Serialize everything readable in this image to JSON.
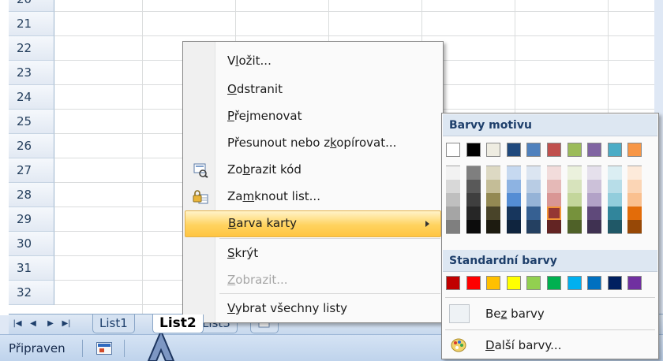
{
  "sheet": {
    "rows": [
      "20",
      "21",
      "22",
      "23",
      "24",
      "25",
      "26",
      "27",
      "28",
      "29",
      "30",
      "31",
      "32"
    ]
  },
  "tabs": {
    "items": [
      {
        "label": "List1",
        "active": false
      },
      {
        "label": "List2",
        "active": true
      },
      {
        "label": "List3",
        "active": false
      }
    ]
  },
  "status": {
    "text": "Připraven"
  },
  "context_menu": {
    "items": [
      {
        "pre": "V",
        "key": "l",
        "post": "ožit...",
        "disabled": false,
        "icon": ""
      },
      {
        "pre": "",
        "key": "O",
        "post": "dstranit",
        "disabled": false,
        "icon": ""
      },
      {
        "pre": "",
        "key": "P",
        "post": "řejmenovat",
        "disabled": false,
        "icon": ""
      },
      {
        "pre": "Přesunout nebo z",
        "key": "k",
        "post": "opírovat...",
        "disabled": false,
        "icon": ""
      },
      {
        "pre": "Zo",
        "key": "b",
        "post": "razit kód",
        "disabled": false,
        "icon": "view-code-icon"
      },
      {
        "pre": "Za",
        "key": "m",
        "post": "knout list...",
        "disabled": false,
        "icon": "lock-sheet-icon"
      },
      {
        "pre": "",
        "key": "B",
        "post": "arva karty",
        "disabled": false,
        "icon": "",
        "highlight": true
      },
      {
        "pre": "",
        "key": "S",
        "post": "krýt",
        "disabled": false,
        "icon": ""
      },
      {
        "pre": "",
        "key": "Z",
        "post": "obrazit...",
        "disabled": true,
        "icon": ""
      },
      {
        "pre": "",
        "key": "V",
        "post": "ybrat všechny listy",
        "disabled": false,
        "icon": ""
      }
    ]
  },
  "color_menu": {
    "theme_title": "Barvy motivu",
    "standard_title": "Standardní barvy",
    "theme_top": [
      "#ffffff",
      "#000000",
      "#eeece1",
      "#1f497d",
      "#4f81bd",
      "#c0504d",
      "#9bbb59",
      "#8064a2",
      "#4bacc6",
      "#f79646"
    ],
    "theme_shades": [
      [
        "#f2f2f2",
        "#d8d8d8",
        "#bfbfbf",
        "#a5a5a5",
        "#7f7f7f"
      ],
      [
        "#7f7f7f",
        "#595959",
        "#3f3f3f",
        "#262626",
        "#0c0c0c"
      ],
      [
        "#ddd9c3",
        "#c4bd97",
        "#938953",
        "#494429",
        "#1d1b10"
      ],
      [
        "#c6d9f0",
        "#8db3e2",
        "#548dd4",
        "#17365d",
        "#0f243e"
      ],
      [
        "#dbe5f1",
        "#b8cce4",
        "#95b3d7",
        "#366092",
        "#244061"
      ],
      [
        "#f2dcdb",
        "#e5b9b7",
        "#d99694",
        "#953734",
        "#632423"
      ],
      [
        "#ebf1dd",
        "#d7e3bc",
        "#c3d69b",
        "#76923c",
        "#4f6128"
      ],
      [
        "#e5e0ec",
        "#ccc1d9",
        "#b2a2c7",
        "#5f497a",
        "#3f3151"
      ],
      [
        "#dbeef3",
        "#b7dde8",
        "#92cddc",
        "#31859b",
        "#205867"
      ],
      [
        "#fdeada",
        "#fbd5b5",
        "#fac08f",
        "#e36c09",
        "#974806"
      ]
    ],
    "selected_shade": {
      "col": 5,
      "row": 3
    },
    "standard": [
      "#c00000",
      "#ff0000",
      "#ffc000",
      "#ffff00",
      "#92d050",
      "#00b050",
      "#00b0f0",
      "#0070c0",
      "#002060",
      "#7030a0"
    ],
    "no_color": {
      "pre": "Be",
      "key": "z",
      "post": " barvy"
    },
    "more_colors": {
      "pre": "",
      "key": "D",
      "post": "alší barvy..."
    }
  }
}
